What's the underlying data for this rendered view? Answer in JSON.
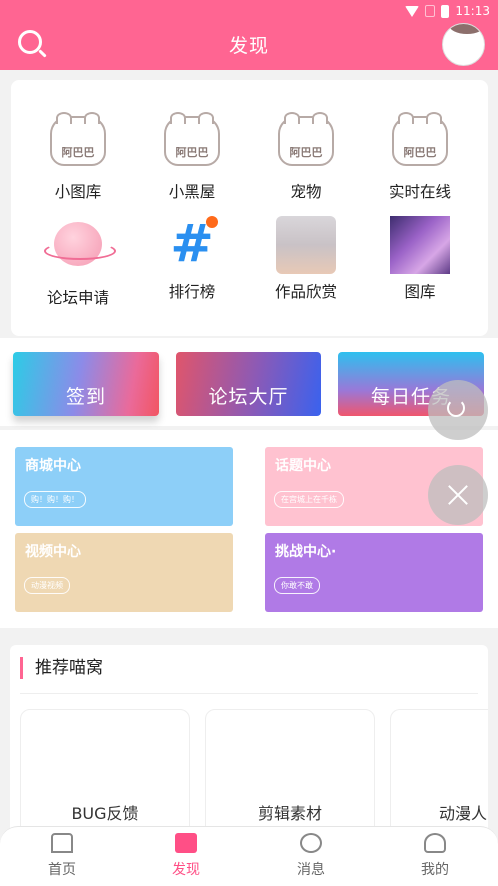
{
  "status": {
    "time": "11:13"
  },
  "header": {
    "title": "发现"
  },
  "grid": {
    "items": [
      {
        "label": "小图库",
        "art": "阿巴巴"
      },
      {
        "label": "小黑屋",
        "art": "阿巴巴"
      },
      {
        "label": "宠物",
        "art": "阿巴巴"
      },
      {
        "label": "实时在线",
        "art": "阿巴巴"
      },
      {
        "label": "论坛申请"
      },
      {
        "label": "排行榜",
        "art": "#"
      },
      {
        "label": "作品欣赏"
      },
      {
        "label": "图库"
      }
    ]
  },
  "actions": {
    "checkin": "签到",
    "forum_hall": "论坛大厅",
    "daily_task": "每日任务"
  },
  "centers": [
    {
      "title": "商城中心",
      "tag": "购！购！购！"
    },
    {
      "title": "话题中心",
      "tag": "在宫城上在千栋"
    },
    {
      "title": "视频中心",
      "tag": "动漫视频"
    },
    {
      "title": "挑战中心·",
      "tag": "你敢不敢"
    }
  ],
  "recommend": {
    "title": "推荐喵窝",
    "cards": [
      "BUG反馈",
      "剪辑素材",
      "动漫人"
    ]
  },
  "bottom_nav": [
    {
      "label": "首页"
    },
    {
      "label": "发现"
    },
    {
      "label": "消息"
    },
    {
      "label": "我的"
    }
  ],
  "colors": {
    "accent": "#ff6592",
    "active_nav": "#ff4f86"
  }
}
